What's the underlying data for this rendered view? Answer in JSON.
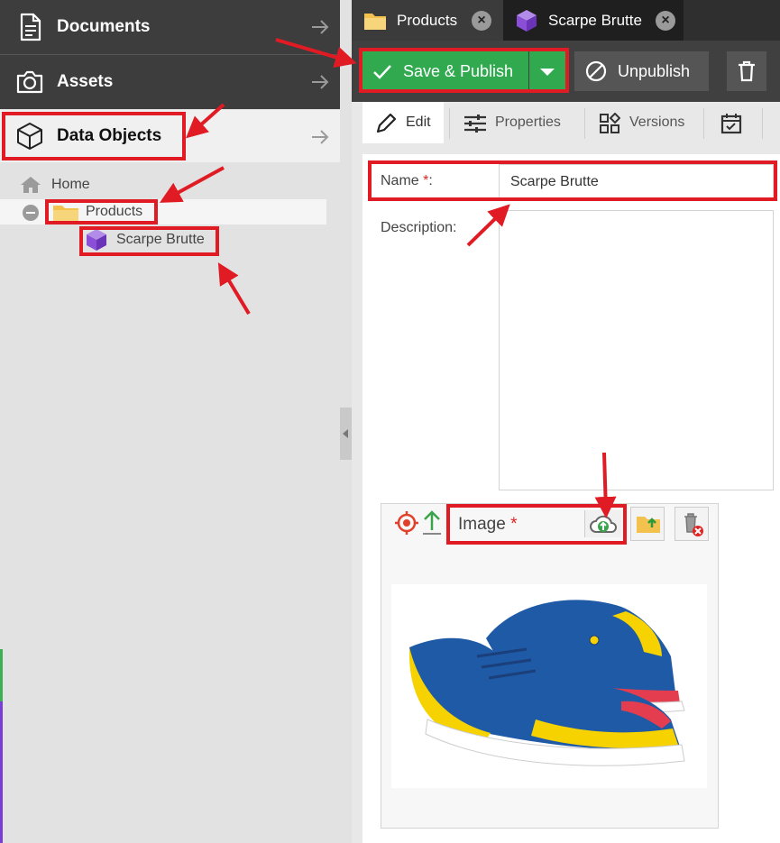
{
  "sidebar": {
    "nav": [
      {
        "label": "Documents",
        "icon": "document-icon"
      },
      {
        "label": "Assets",
        "icon": "camera-icon"
      },
      {
        "label": "Data Objects",
        "icon": "cube-icon"
      }
    ],
    "tree": {
      "home": "Home",
      "folder": "Products",
      "item": "Scarpe Brutte"
    }
  },
  "tabs": [
    {
      "label": "Products",
      "icon": "folder-icon"
    },
    {
      "label": "Scarpe Brutte",
      "icon": "object-cube-icon"
    }
  ],
  "toolbar": {
    "save_label": "Save & Publish",
    "unpublish_label": "Unpublish"
  },
  "subtabs": {
    "edit": "Edit",
    "properties": "Properties",
    "versions": "Versions"
  },
  "form": {
    "name_label": "Name",
    "name_required": "*",
    "name_colon": ":",
    "name_value": "Scarpe Brutte",
    "description_label": "Description:",
    "description_value": "",
    "image_label": "Image",
    "image_required": "*"
  },
  "colors": {
    "accent_green": "#30a94f",
    "annotation_red": "#e01b24",
    "dark_panel": "#3d3d3d"
  }
}
